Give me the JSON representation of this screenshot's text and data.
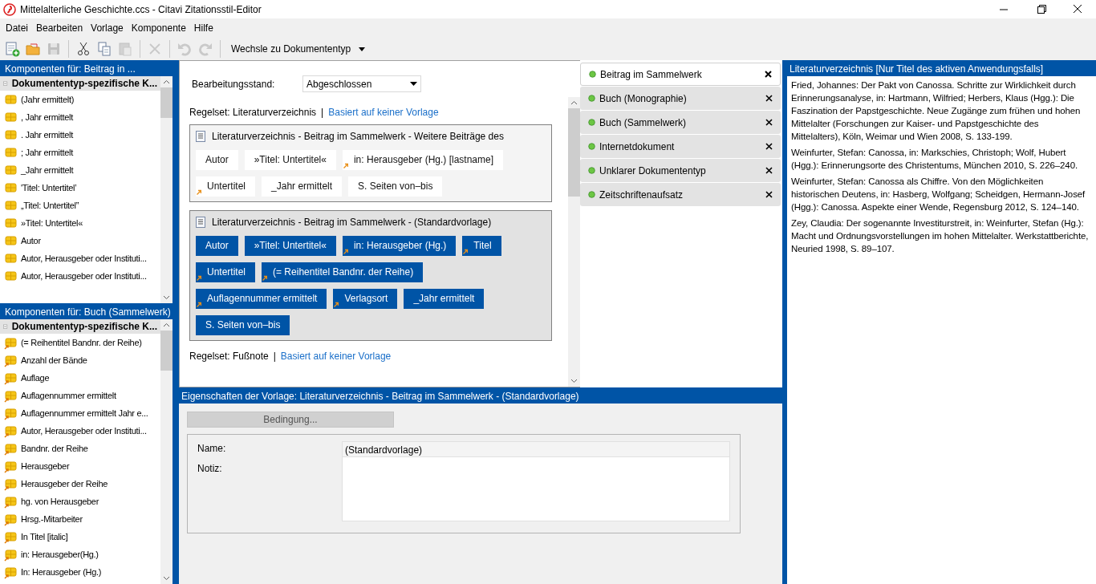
{
  "window": {
    "title": "Mittelalterliche Geschichte.ccs - Citavi Zitationsstil-Editor"
  },
  "menu": [
    "Datei",
    "Bearbeiten",
    "Vorlage",
    "Komponente",
    "Hilfe"
  ],
  "toolbar": [
    {
      "kind": "new",
      "disabled": false
    },
    {
      "kind": "open",
      "disabled": false
    },
    {
      "kind": "save",
      "disabled": true
    },
    {
      "kind": "sep"
    },
    {
      "kind": "cut",
      "disabled": false
    },
    {
      "kind": "copy",
      "disabled": false
    },
    {
      "kind": "paste",
      "disabled": true
    },
    {
      "kind": "sep"
    },
    {
      "kind": "delete",
      "disabled": true
    },
    {
      "kind": "sep"
    },
    {
      "kind": "undo",
      "disabled": true
    },
    {
      "kind": "redo",
      "disabled": true
    },
    {
      "kind": "sep"
    }
  ],
  "toolbar_dropdown": {
    "label": "Wechsle zu Dokumententyp"
  },
  "component_panels": [
    {
      "title": "Komponenten für: Beitrag in ...",
      "group": "Dokumententyp-spezifische K...",
      "expanded": true,
      "items": [
        {
          "label": "(Jahr ermittelt)",
          "linked": false
        },
        {
          "label": ", Jahr ermittelt",
          "linked": false
        },
        {
          "label": ". Jahr ermittelt",
          "linked": false
        },
        {
          "label": "; Jahr ermittelt",
          "linked": false
        },
        {
          "label": "_Jahr ermittelt",
          "linked": false
        },
        {
          "label": "'Titel: Untertitel’",
          "linked": false
        },
        {
          "label": "„Titel: Untertitel”",
          "linked": false
        },
        {
          "label": "»Titel: Untertitel«",
          "linked": false
        },
        {
          "label": "Autor",
          "linked": false
        },
        {
          "label": "Autor, Herausgeber oder Instituti...",
          "linked": false
        },
        {
          "label": "Autor, Herausgeber oder Instituti...",
          "linked": false
        }
      ]
    },
    {
      "title": "Komponenten für: Buch (Sammelwerk)",
      "group": "Dokumententyp-spezifische K...",
      "expanded": true,
      "items": [
        {
          "label": "(= Reihentitel Bandnr. der Reihe)",
          "linked": true
        },
        {
          "label": "Anzahl der Bände",
          "linked": true
        },
        {
          "label": "Auflage",
          "linked": true
        },
        {
          "label": "Auflagennummer ermittelt",
          "linked": true
        },
        {
          "label": "Auflagennummer ermittelt Jahr e...",
          "linked": true
        },
        {
          "label": "Autor, Herausgeber oder Instituti...",
          "linked": true
        },
        {
          "label": "Bandnr. der Reihe",
          "linked": true
        },
        {
          "label": "Herausgeber",
          "linked": true
        },
        {
          "label": "Herausgeber der Reihe",
          "linked": true
        },
        {
          "label": "hg. von Herausgeber",
          "linked": true
        },
        {
          "label": "Hrsg.-Mitarbeiter",
          "linked": true
        },
        {
          "label": "In Titel [italic]",
          "linked": true
        },
        {
          "label": "in: Herausgeber(Hg.)",
          "linked": true
        },
        {
          "label": "In: Herausgeber (Hg.)",
          "linked": true
        }
      ]
    }
  ],
  "editor": {
    "status_label": "Bearbeitungsstand:",
    "status_value": "Abgeschlossen",
    "rulesets": [
      {
        "label": "Regelset: Literaturverzeichnis",
        "separator": "|",
        "link": "Basiert auf keiner Vorlage",
        "templates": [
          {
            "title": "Literaturverzeichnis - Beitrag im Sammelwerk - Weitere Beiträge des",
            "selected": false,
            "components": [
              {
                "label": "Autor",
                "linked": false
              },
              {
                "label": "»Titel: Untertitel«",
                "linked": false
              },
              {
                "label": "in: Herausgeber (Hg.) [lastname]",
                "linked": true
              },
              {
                "label": "Untertitel",
                "linked": true
              },
              {
                "label": "_Jahr ermittelt",
                "linked": false
              },
              {
                "label": "S. Seiten von–bis",
                "linked": false
              }
            ]
          },
          {
            "title": "Literaturverzeichnis - Beitrag im Sammelwerk - (Standardvorlage)",
            "selected": true,
            "components": [
              {
                "label": "Autor",
                "linked": false
              },
              {
                "label": "»Titel: Untertitel«",
                "linked": false
              },
              {
                "label": "in: Herausgeber (Hg.)",
                "linked": true
              },
              {
                "label": "Titel",
                "linked": true
              },
              {
                "label": "Untertitel",
                "linked": true
              },
              {
                "label": "(= Reihentitel Bandnr. der Reihe)",
                "linked": true
              },
              {
                "label": "Auflagennummer ermittelt",
                "linked": true
              },
              {
                "label": "Verlagsort",
                "linked": true
              },
              {
                "label": "_Jahr ermittelt",
                "linked": false
              },
              {
                "label": "S. Seiten von–bis",
                "linked": false
              }
            ]
          }
        ]
      },
      {
        "label": "Regelset: Fußnote",
        "separator": "|",
        "link": "Basiert auf keiner Vorlage"
      }
    ]
  },
  "document_types": [
    {
      "label": "Beitrag im Sammelwerk",
      "selected": true
    },
    {
      "label": "Buch (Monographie)",
      "selected": false
    },
    {
      "label": "Buch (Sammelwerk)",
      "selected": false
    },
    {
      "label": "Internetdokument",
      "selected": false
    },
    {
      "label": "Unklarer Dokumententyp",
      "selected": false
    },
    {
      "label": "Zeitschriftenaufsatz",
      "selected": false
    }
  ],
  "properties": {
    "title": "Eigenschaften der Vorlage:  Literaturverzeichnis - Beitrag im Sammelwerk - (Standardvorlage)",
    "condition_button": "Bedingung...",
    "name_label": "Name:",
    "name_value": "(Standardvorlage)",
    "note_label": "Notiz:"
  },
  "preview": {
    "title": "Literaturverzeichnis [Nur Titel des aktiven Anwendungsfalls]",
    "entries": [
      "Fried, Johannes: Der Pakt von Canossa. Schritte zur Wirklichkeit durch Erinnerungsanalyse, in: Hartmann, Wilfried; Herbers, Klaus (Hgg.): Die Faszination der Papstgeschichte. Neue Zugänge zum frühen und hohen Mittelalter (Forschungen zur Kaiser- und Papstgeschichte des Mittelalters), Köln, Weimar und Wien 2008, S. 133-199.",
      "Weinfurter, Stefan: Canossa, in: Markschies, Christoph; Wolf, Hubert (Hgg.): Erinnerungsorte des Christentums, München 2010, S. 226–240.",
      "Weinfurter, Stefan: Canossa als Chiffre. Von den Möglichkeiten historischen Deutens, in: Hasberg, Wolfgang; Scheidgen, Hermann-Josef (Hgg.): Canossa. Aspekte einer Wende, Regensburg 2012, S. 124–140.",
      "Zey, Claudia: Der sogenannte Investiturstreit, in: Weinfurter, Stefan (Hg.): Macht und Ordnungsvorstellungen im hohen Mittelalter. Werkstattberichte, Neuried 1998, S. 89–107."
    ]
  }
}
